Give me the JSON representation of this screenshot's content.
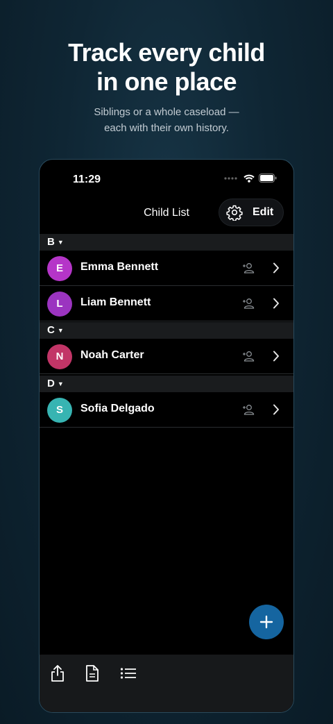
{
  "promo": {
    "headline_line1": "Track every child",
    "headline_line2": "in one place",
    "sub_line1": "Siblings or a whole caseload —",
    "sub_line2": "each with their own history."
  },
  "status_bar": {
    "time": "11:29"
  },
  "nav": {
    "title": "Child List",
    "edit_label": "Edit"
  },
  "sections": [
    {
      "letter": "B",
      "children": [
        {
          "initial": "E",
          "name": "Emma Bennett",
          "color": "#b535c8"
        },
        {
          "initial": "L",
          "name": "Liam Bennett",
          "color": "#9b34c0"
        }
      ]
    },
    {
      "letter": "C",
      "children": [
        {
          "initial": "N",
          "name": "Noah Carter",
          "color": "#c23567"
        }
      ]
    },
    {
      "letter": "D",
      "children": [
        {
          "initial": "S",
          "name": "Sofia Delgado",
          "color": "#37b4b2"
        }
      ]
    }
  ],
  "icons": {
    "status": [
      "signal-dots-icon",
      "wifi-icon",
      "battery-icon"
    ],
    "nav": [
      "gear-icon"
    ],
    "row": [
      "person-add-icon",
      "chevron-right-icon"
    ],
    "fab": "plus-icon",
    "toolbar": [
      "share-icon",
      "document-icon",
      "list-icon"
    ]
  },
  "colors": {
    "accent": "#1565a0",
    "section_bg": "#1a1c1e",
    "screen_bg": "#000000"
  }
}
